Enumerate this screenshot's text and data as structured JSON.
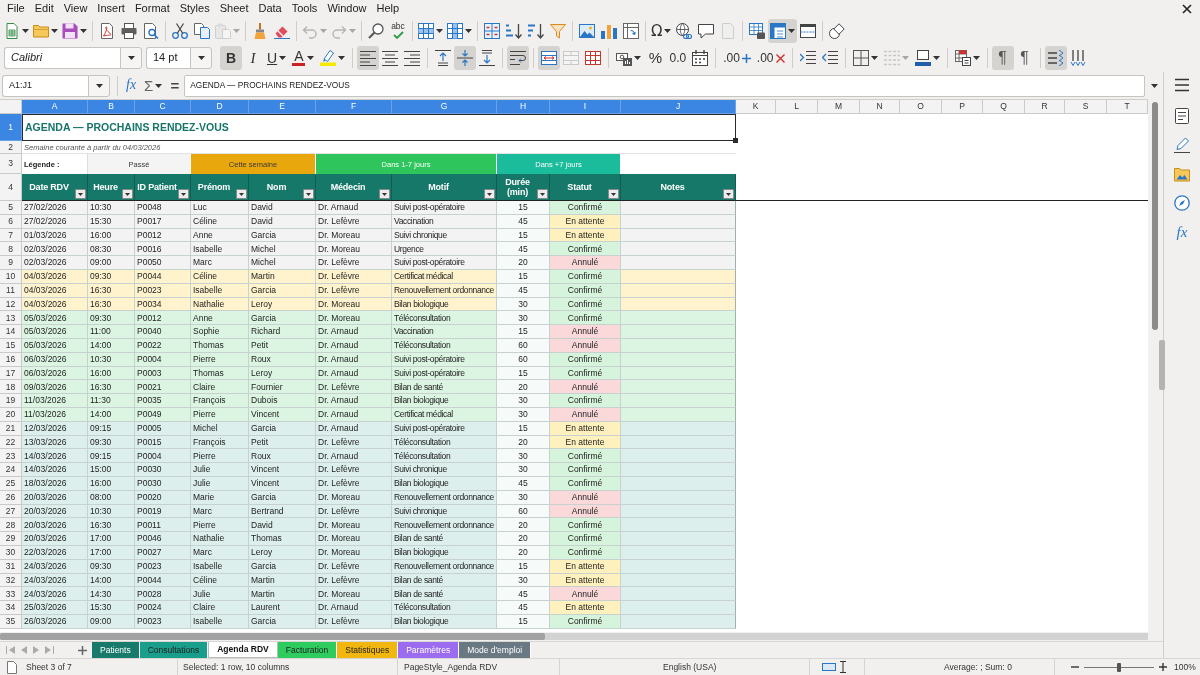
{
  "menu": [
    "File",
    "Edit",
    "View",
    "Insert",
    "Format",
    "Styles",
    "Sheet",
    "Data",
    "Tools",
    "Window",
    "Help"
  ],
  "standard_toolbar": [
    {
      "pressed": false,
      "disabled": false
    },
    {
      "pressed": false,
      "disabled": false
    },
    {
      "pressed": false,
      "disabled": false
    },
    {
      "pressed": false,
      "disabled": false
    },
    {
      "pressed": false,
      "disabled": false
    },
    {
      "pressed": false,
      "disabled": false
    },
    {
      "pressed": false,
      "disabled": false
    },
    {
      "pressed": false,
      "disabled": false
    },
    {
      "pressed": false,
      "disabled": true
    },
    {
      "pressed": false,
      "disabled": false
    },
    {
      "pressed": false,
      "disabled": false
    },
    {
      "pressed": false,
      "disabled": true
    },
    {
      "pressed": false,
      "disabled": true
    },
    {
      "pressed": false,
      "disabled": false
    },
    {
      "label": "abc",
      "pressed": false,
      "disabled": false
    },
    {
      "pressed": false,
      "disabled": false
    },
    {
      "pressed": false,
      "disabled": false
    },
    {
      "pressed": false,
      "disabled": false
    },
    {
      "pressed": false,
      "disabled": false
    },
    {
      "pressed": false,
      "disabled": false
    },
    {
      "pressed": false,
      "disabled": false
    },
    {
      "pressed": false,
      "disabled": false
    },
    {
      "pressed": false,
      "disabled": false
    },
    {
      "pressed": false,
      "disabled": false
    },
    {
      "label": "Ω",
      "pressed": false,
      "disabled": false
    },
    {
      "pressed": false,
      "disabled": false
    },
    {
      "pressed": false,
      "disabled": false
    },
    {
      "pressed": false,
      "disabled": true
    },
    {
      "pressed": false,
      "disabled": false
    },
    {
      "pressed": true,
      "disabled": false
    },
    {
      "pressed": false,
      "disabled": false
    },
    {
      "pressed": false,
      "disabled": false
    }
  ],
  "formatting_toolbar": {
    "font_name": "Calibri",
    "font_size": "14 pt",
    "buttons": [
      {
        "label": "B",
        "pressed": true,
        "disabled": false
      },
      {
        "label": "I",
        "pressed": false,
        "disabled": false
      },
      {
        "label": "U",
        "pressed": false,
        "disabled": false
      },
      {
        "label": "A",
        "pressed": false,
        "disabled": false
      },
      {
        "pressed": false,
        "disabled": false
      },
      {
        "pressed": true,
        "disabled": false
      },
      {
        "pressed": false,
        "disabled": false
      },
      {
        "pressed": false,
        "disabled": false
      },
      {
        "pressed": false,
        "disabled": false
      },
      {
        "pressed": true,
        "disabled": false
      },
      {
        "pressed": false,
        "disabled": false
      },
      {
        "pressed": true,
        "disabled": false
      },
      {
        "pressed": true,
        "disabled": false
      },
      {
        "pressed": false,
        "disabled": true
      },
      {
        "pressed": false,
        "disabled": false
      },
      {
        "pressed": false,
        "disabled": false
      },
      {
        "label": "%",
        "pressed": false,
        "disabled": false
      },
      {
        "label": "0.0",
        "pressed": false,
        "disabled": false
      },
      {
        "pressed": false,
        "disabled": false
      },
      {
        "label": ".00",
        "pressed": false,
        "disabled": false
      },
      {
        "label": ".00",
        "pressed": false,
        "disabled": false
      },
      {
        "pressed": false,
        "disabled": false
      },
      {
        "pressed": false,
        "disabled": false
      },
      {
        "pressed": false,
        "disabled": false
      },
      {
        "pressed": false,
        "disabled": true
      },
      {
        "pressed": false,
        "disabled": false
      },
      {
        "pressed": false,
        "disabled": false
      },
      {
        "label": "¶",
        "pressed": true,
        "disabled": false
      },
      {
        "label": "¶",
        "pressed": false,
        "disabled": false
      },
      {
        "pressed": true,
        "disabled": false
      },
      {
        "pressed": false,
        "disabled": false
      }
    ]
  },
  "formula_bar": {
    "name_box": "A1:J1",
    "function_wizard": "fx",
    "sum": "Σ",
    "equals": "=",
    "formula": "AGENDA — PROCHAINS RENDEZ-VOUS"
  },
  "sheet": {
    "column_headers": [
      {
        "label": "A",
        "selected": true
      },
      {
        "label": "B",
        "selected": true
      },
      {
        "label": "C",
        "selected": true
      },
      {
        "label": "D",
        "selected": true
      },
      {
        "label": "E",
        "selected": true
      },
      {
        "label": "F",
        "selected": true
      },
      {
        "label": "G",
        "selected": true
      },
      {
        "label": "H",
        "selected": true
      },
      {
        "label": "I",
        "selected": true
      },
      {
        "label": "J",
        "selected": true
      },
      {
        "label": "K",
        "selected": false
      },
      {
        "label": "L",
        "selected": false
      },
      {
        "label": "M",
        "selected": false
      },
      {
        "label": "N",
        "selected": false
      },
      {
        "label": "O",
        "selected": false
      },
      {
        "label": "P",
        "selected": false
      },
      {
        "label": "Q",
        "selected": false
      },
      {
        "label": "R",
        "selected": false
      },
      {
        "label": "S",
        "selected": false
      },
      {
        "label": "T",
        "selected": false
      }
    ],
    "title_row": {
      "number": "1",
      "selected": true,
      "text": "AGENDA — PROCHAINS RENDEZ-VOUS"
    },
    "subtitle_row": {
      "number": "2",
      "selected": false,
      "text": "Semaine courante à partir du 04/03/2026"
    },
    "legend_row": {
      "number": "3",
      "selected": false,
      "label": "Légende :",
      "items": [
        {
          "label": "Passé",
          "color": "#f4f4f4"
        },
        {
          "label": "Cette semaine",
          "color": "#e8a70c"
        },
        {
          "label": "Dans 1-7 jours",
          "color": "#2ec55c"
        },
        {
          "label": "Dans +7 jours",
          "color": "#1abc9c"
        }
      ]
    },
    "header_row": {
      "number": "4",
      "selected": false,
      "columns": [
        "Date RDV",
        "Heure",
        "ID Patient",
        "Prénom",
        "Nom",
        "Médecin",
        "Motif",
        "Durée (min)",
        "Statut",
        "Notes"
      ]
    },
    "rows": [
      {
        "number": "5",
        "selected": false,
        "kind": "past",
        "cells": [
          "27/02/2026",
          "10:30",
          "P0048",
          "Luc",
          "David",
          "Dr. Arnaud",
          "Suivi post-opératoire",
          "15"
        ],
        "status": {
          "label": "Confirmé",
          "kind": "confirmed"
        }
      },
      {
        "number": "6",
        "selected": false,
        "kind": "past",
        "cells": [
          "27/02/2026",
          "15:30",
          "P0017",
          "Céline",
          "David",
          "Dr. Lefèvre",
          "Vaccination",
          "45"
        ],
        "status": {
          "label": "En attente",
          "kind": "pending"
        }
      },
      {
        "number": "7",
        "selected": false,
        "kind": "past",
        "cells": [
          "01/03/2026",
          "16:00",
          "P0012",
          "Anne",
          "Garcia",
          "Dr. Moreau",
          "Suivi chronique",
          "15"
        ],
        "status": {
          "label": "En attente",
          "kind": "pending"
        }
      },
      {
        "number": "8",
        "selected": false,
        "kind": "past",
        "cells": [
          "02/03/2026",
          "08:30",
          "P0016",
          "Isabelle",
          "Michel",
          "Dr. Moreau",
          "Urgence",
          "45"
        ],
        "status": {
          "label": "Confirmé",
          "kind": "confirmed"
        }
      },
      {
        "number": "9",
        "selected": false,
        "kind": "past",
        "cells": [
          "02/03/2026",
          "09:00",
          "P0050",
          "Marc",
          "Michel",
          "Dr. Lefèvre",
          "Suivi post-opératoire",
          "20"
        ],
        "status": {
          "label": "Annulé",
          "kind": "cancelled"
        }
      },
      {
        "number": "10",
        "selected": false,
        "kind": "this_week",
        "cells": [
          "04/03/2026",
          "09:30",
          "P0044",
          "Céline",
          "Martin",
          "Dr. Lefèvre",
          "Certificat médical",
          "15"
        ],
        "status": {
          "label": "Confirmé",
          "kind": "confirmed"
        }
      },
      {
        "number": "11",
        "selected": false,
        "kind": "this_week",
        "cells": [
          "04/03/2026",
          "16:30",
          "P0023",
          "Isabelle",
          "Garcia",
          "Dr. Lefèvre",
          "Renouvellement ordonnance",
          "45"
        ],
        "status": {
          "label": "Confirmé",
          "kind": "confirmed"
        }
      },
      {
        "number": "12",
        "selected": false,
        "kind": "this_week",
        "cells": [
          "04/03/2026",
          "16:30",
          "P0034",
          "Nathalie",
          "Leroy",
          "Dr. Moreau",
          "Bilan biologique",
          "30"
        ],
        "status": {
          "label": "Confirmé",
          "kind": "confirmed"
        }
      },
      {
        "number": "13",
        "selected": false,
        "kind": "next_days",
        "cells": [
          "05/03/2026",
          "09:30",
          "P0012",
          "Anne",
          "Garcia",
          "Dr. Moreau",
          "Téléconsultation",
          "30"
        ],
        "status": {
          "label": "Confirmé",
          "kind": "confirmed"
        }
      },
      {
        "number": "14",
        "selected": false,
        "kind": "next_days",
        "cells": [
          "05/03/2026",
          "11:00",
          "P0040",
          "Sophie",
          "Richard",
          "Dr. Arnaud",
          "Vaccination",
          "15"
        ],
        "status": {
          "label": "Annulé",
          "kind": "cancelled"
        }
      },
      {
        "number": "15",
        "selected": false,
        "kind": "next_days",
        "cells": [
          "05/03/2026",
          "14:00",
          "P0022",
          "Thomas",
          "Petit",
          "Dr. Arnaud",
          "Téléconsultation",
          "60"
        ],
        "status": {
          "label": "Annulé",
          "kind": "cancelled"
        }
      },
      {
        "number": "16",
        "selected": false,
        "kind": "next_days",
        "cells": [
          "06/03/2026",
          "10:30",
          "P0004",
          "Pierre",
          "Roux",
          "Dr. Arnaud",
          "Suivi post-opératoire",
          "60"
        ],
        "status": {
          "label": "Confirmé",
          "kind": "confirmed"
        }
      },
      {
        "number": "17",
        "selected": false,
        "kind": "next_days",
        "cells": [
          "06/03/2026",
          "16:00",
          "P0003",
          "Thomas",
          "Leroy",
          "Dr. Arnaud",
          "Suivi post-opératoire",
          "15"
        ],
        "status": {
          "label": "Confirmé",
          "kind": "confirmed"
        }
      },
      {
        "number": "18",
        "selected": false,
        "kind": "next_days",
        "cells": [
          "09/03/2026",
          "16:30",
          "P0021",
          "Claire",
          "Fournier",
          "Dr. Lefèvre",
          "Bilan de santé",
          "20"
        ],
        "status": {
          "label": "Annulé",
          "kind": "cancelled"
        }
      },
      {
        "number": "19",
        "selected": false,
        "kind": "next_days",
        "cells": [
          "11/03/2026",
          "11:30",
          "P0035",
          "François",
          "Dubois",
          "Dr. Arnaud",
          "Bilan biologique",
          "30"
        ],
        "status": {
          "label": "Confirmé",
          "kind": "confirmed"
        }
      },
      {
        "number": "20",
        "selected": false,
        "kind": "next_days",
        "cells": [
          "11/03/2026",
          "14:00",
          "P0049",
          "Pierre",
          "Vincent",
          "Dr. Arnaud",
          "Certificat médical",
          "30"
        ],
        "status": {
          "label": "Annulé",
          "kind": "cancelled"
        }
      },
      {
        "number": "21",
        "selected": false,
        "kind": "later",
        "cells": [
          "12/03/2026",
          "09:15",
          "P0005",
          "Michel",
          "Garcia",
          "Dr. Arnaud",
          "Suivi post-opératoire",
          "15"
        ],
        "status": {
          "label": "En attente",
          "kind": "pending"
        }
      },
      {
        "number": "22",
        "selected": false,
        "kind": "later",
        "cells": [
          "13/03/2026",
          "09:30",
          "P0015",
          "François",
          "Petit",
          "Dr. Lefèvre",
          "Téléconsultation",
          "20"
        ],
        "status": {
          "label": "En attente",
          "kind": "pending"
        }
      },
      {
        "number": "23",
        "selected": false,
        "kind": "later",
        "cells": [
          "14/03/2026",
          "09:15",
          "P0004",
          "Pierre",
          "Roux",
          "Dr. Arnaud",
          "Téléconsultation",
          "30"
        ],
        "status": {
          "label": "Confirmé",
          "kind": "confirmed"
        }
      },
      {
        "number": "24",
        "selected": false,
        "kind": "later",
        "cells": [
          "14/03/2026",
          "15:00",
          "P0030",
          "Julie",
          "Vincent",
          "Dr. Lefèvre",
          "Suivi chronique",
          "30"
        ],
        "status": {
          "label": "Confirmé",
          "kind": "confirmed"
        }
      },
      {
        "number": "25",
        "selected": false,
        "kind": "later",
        "cells": [
          "18/03/2026",
          "16:00",
          "P0030",
          "Julie",
          "Vincent",
          "Dr. Lefèvre",
          "Bilan biologique",
          "45"
        ],
        "status": {
          "label": "Confirmé",
          "kind": "confirmed"
        }
      },
      {
        "number": "26",
        "selected": false,
        "kind": "later",
        "cells": [
          "20/03/2026",
          "08:00",
          "P0020",
          "Marie",
          "Garcia",
          "Dr. Moreau",
          "Renouvellement ordonnance",
          "30"
        ],
        "status": {
          "label": "Annulé",
          "kind": "cancelled"
        }
      },
      {
        "number": "27",
        "selected": false,
        "kind": "later",
        "cells": [
          "20/03/2026",
          "10:30",
          "P0019",
          "Marc",
          "Bertrand",
          "Dr. Lefèvre",
          "Suivi chronique",
          "60"
        ],
        "status": {
          "label": "Annulé",
          "kind": "cancelled"
        }
      },
      {
        "number": "28",
        "selected": false,
        "kind": "later",
        "cells": [
          "20/03/2026",
          "16:30",
          "P0011",
          "Pierre",
          "David",
          "Dr. Moreau",
          "Renouvellement ordonnance",
          "20"
        ],
        "status": {
          "label": "Confirmé",
          "kind": "confirmed"
        }
      },
      {
        "number": "29",
        "selected": false,
        "kind": "later",
        "cells": [
          "20/03/2026",
          "17:00",
          "P0046",
          "Nathalie",
          "Thomas",
          "Dr. Moreau",
          "Bilan de santé",
          "20"
        ],
        "status": {
          "label": "Confirmé",
          "kind": "confirmed"
        }
      },
      {
        "number": "30",
        "selected": false,
        "kind": "later",
        "cells": [
          "22/03/2026",
          "17:00",
          "P0027",
          "Marc",
          "Leroy",
          "Dr. Moreau",
          "Bilan biologique",
          "20"
        ],
        "status": {
          "label": "Confirmé",
          "kind": "confirmed"
        }
      },
      {
        "number": "31",
        "selected": false,
        "kind": "later",
        "cells": [
          "24/03/2026",
          "09:30",
          "P0023",
          "Isabelle",
          "Garcia",
          "Dr. Lefèvre",
          "Renouvellement ordonnance",
          "15"
        ],
        "status": {
          "label": "En attente",
          "kind": "pending"
        }
      },
      {
        "number": "32",
        "selected": false,
        "kind": "later",
        "cells": [
          "24/03/2026",
          "14:00",
          "P0044",
          "Céline",
          "Martin",
          "Dr. Lefèvre",
          "Bilan de santé",
          "30"
        ],
        "status": {
          "label": "En attente",
          "kind": "pending"
        }
      },
      {
        "number": "33",
        "selected": false,
        "kind": "later",
        "cells": [
          "24/03/2026",
          "14:30",
          "P0028",
          "Julie",
          "Martin",
          "Dr. Moreau",
          "Bilan de santé",
          "45"
        ],
        "status": {
          "label": "Annulé",
          "kind": "cancelled"
        }
      },
      {
        "number": "34",
        "selected": false,
        "kind": "later",
        "cells": [
          "25/03/2026",
          "15:30",
          "P0024",
          "Claire",
          "Laurent",
          "Dr. Arnaud",
          "Téléconsultation",
          "45"
        ],
        "status": {
          "label": "En attente",
          "kind": "pending"
        }
      },
      {
        "number": "35",
        "selected": false,
        "kind": "later",
        "cells": [
          "26/03/2026",
          "09:00",
          "P0023",
          "Isabelle",
          "Garcia",
          "Dr. Lefèvre",
          "Bilan biologique",
          "15"
        ],
        "status": {
          "label": "Confirmé",
          "kind": "confirmed"
        }
      }
    ]
  },
  "sheet_tabs": [
    {
      "label": "Patients",
      "color": "#177a6b",
      "selected": false
    },
    {
      "label": "Consultations",
      "color": "#1a9e8c",
      "selected": false
    },
    {
      "label": "Agenda RDV",
      "selected": true
    },
    {
      "label": "Facturation",
      "color": "#2ecc5f",
      "selected": false
    },
    {
      "label": "Statistiques",
      "color": "#f1b70e",
      "selected": false
    },
    {
      "label": "Paramètres",
      "color": "#9b6cf0",
      "selected": false
    },
    {
      "label": "Mode d'emploi",
      "color": "#6a7883",
      "selected": false
    }
  ],
  "sidebar": {
    "functions": "fx"
  },
  "status_bar": {
    "sheet": "Sheet 3 of 7",
    "selection": "Selected: 1 row, 10 columns",
    "page_style": "PageStyle_Agenda RDV",
    "language": "English (USA)",
    "summary": "Average: ; Sum: 0",
    "zoom_slider": {
      "level": 0.5
    },
    "zoom": "100%"
  }
}
